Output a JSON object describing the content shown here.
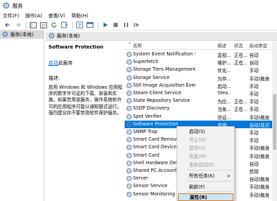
{
  "window": {
    "title": "服务"
  },
  "menu": [
    "文件(F)",
    "操作(A)",
    "查看(V)",
    "帮助(H)"
  ],
  "tree": {
    "root_label": "服务(本地)"
  },
  "pane": {
    "header": "服务(本地)"
  },
  "description": {
    "service_name": "Software Protection",
    "start_link": "启动",
    "start_rest": "此服务",
    "label": "描述:",
    "text": "启用 Windows 和 Windows 应用程序的数字许可证的下载、安装和实施。如果禁用该服务，操作系统和许可的应用程序可能以通知模式运行。强烈建议你不要禁用软件保护服务。"
  },
  "columns": {
    "name": "名称",
    "description": "描述",
    "status": "状态",
    "startup": "启动类型"
  },
  "rows": [
    {
      "name": "System Event Notification Service",
      "desc": "监视...",
      "status": "正在...",
      "startup": "自动"
    },
    {
      "name": "Superfetch",
      "desc": "维护...",
      "status": "正在...",
      "startup": "自动"
    },
    {
      "name": "Storage Tiers Management",
      "desc": "优化...",
      "status": "",
      "startup": "手动"
    },
    {
      "name": "Storage Service",
      "desc": "为存...",
      "status": "",
      "startup": "手动(触发"
    },
    {
      "name": "Still Image Acquisition Events",
      "desc": "启动...",
      "status": "",
      "startup": "手动"
    },
    {
      "name": "Steam Client Service",
      "desc": "Stea...",
      "status": "",
      "startup": "手动"
    },
    {
      "name": "State Repository Service",
      "desc": "为应...",
      "status": "正在...",
      "startup": "手动"
    },
    {
      "name": "SSDP Discovery",
      "desc": "当发...",
      "status": "正在...",
      "startup": "手动"
    },
    {
      "name": "Spot Verifier",
      "desc": "验证...",
      "status": "",
      "startup": "手动(触发"
    },
    {
      "name": "Software Protection",
      "desc": "启用...",
      "status": "",
      "startup": "自动(延迟"
    },
    {
      "name": "SNMP Trap",
      "desc": "",
      "status": "",
      "startup": "手动"
    },
    {
      "name": "Smart Card Removal",
      "desc": "",
      "status": "",
      "startup": "手动"
    },
    {
      "name": "Smart Card Device E",
      "desc": "",
      "status": "",
      "startup": "手动(触发"
    },
    {
      "name": "Smart Card",
      "desc": "",
      "status": "",
      "startup": "手动(触发"
    },
    {
      "name": "Shell Hardware Dete",
      "desc": "",
      "status": "",
      "startup": "自动"
    },
    {
      "name": "Shared PC Account M",
      "desc": "",
      "status": "",
      "startup": "禁用"
    },
    {
      "name": "Server",
      "desc": "",
      "status": "",
      "startup": "自动(触发"
    },
    {
      "name": "Sensor Service",
      "desc": "",
      "status": "",
      "startup": "手动(触发"
    },
    {
      "name": "Sensor Monitoring S",
      "desc": "",
      "status": "",
      "startup": "手动(触发"
    }
  ],
  "context_menu": {
    "items": [
      {
        "label": "启动(S)",
        "disabled": false
      },
      {
        "label": "停止(O)",
        "disabled": true
      },
      {
        "label": "暂停(U)",
        "disabled": true
      },
      {
        "label": "恢复(M)",
        "disabled": true
      },
      {
        "label": "重新启动(E)",
        "disabled": true
      },
      {
        "label": "所有任务(K)",
        "disabled": false,
        "submenu_arrow": ">"
      },
      {
        "label": "刷新(F)",
        "disabled": false
      },
      {
        "label": "属性(R)",
        "disabled": false,
        "highlighted": true
      }
    ]
  },
  "colors": {
    "selection": "#0078d7",
    "link": "#0066cc",
    "highlight_border": "#e07b1b"
  }
}
